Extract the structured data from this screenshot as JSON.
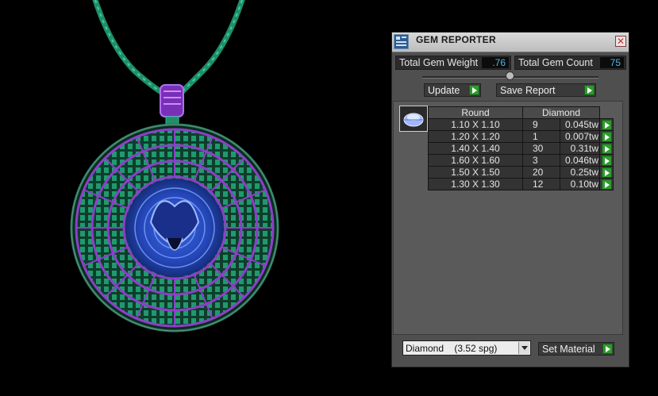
{
  "panel": {
    "title": "GEM REPORTER",
    "close_glyph": "✕",
    "total_weight_label": "Total Gem Weight",
    "total_weight_value": ".76",
    "total_count_label": "Total Gem Count",
    "total_count_value": "75",
    "update_label": "Update",
    "save_report_label": "Save Report",
    "table": {
      "headers": [
        "Round",
        "Diamond"
      ],
      "rows": [
        {
          "size": "1.10 X 1.10",
          "count": "9",
          "weight": "0.045tw"
        },
        {
          "size": "1.20 X 1.20",
          "count": "1",
          "weight": "0.007tw"
        },
        {
          "size": "1.40 X 1.40",
          "count": "30",
          "weight": "0.31tw"
        },
        {
          "size": "1.60 X 1.60",
          "count": "3",
          "weight": "0.046tw"
        },
        {
          "size": "1.50 X 1.50",
          "count": "20",
          "weight": "0.25tw"
        },
        {
          "size": "1.30 X 1.30",
          "count": "12",
          "weight": "0.10tw"
        }
      ]
    },
    "material_value": "Diamond    (3.52 spg)",
    "set_material_label": "Set Material"
  },
  "colors": {
    "accent_value": "#4fb7e6",
    "play_green": "#2f9a2f",
    "pendant_green": "#1e8f6a",
    "pendant_purple": "#8c3fc9",
    "pendant_blue": "#2446b8"
  },
  "icons": {
    "app": "gem-reporter-icon",
    "close": "close-icon",
    "gem_thumb": "round-gem-icon",
    "play": "play-arrow-icon",
    "dropdown": "chevron-down-icon"
  }
}
